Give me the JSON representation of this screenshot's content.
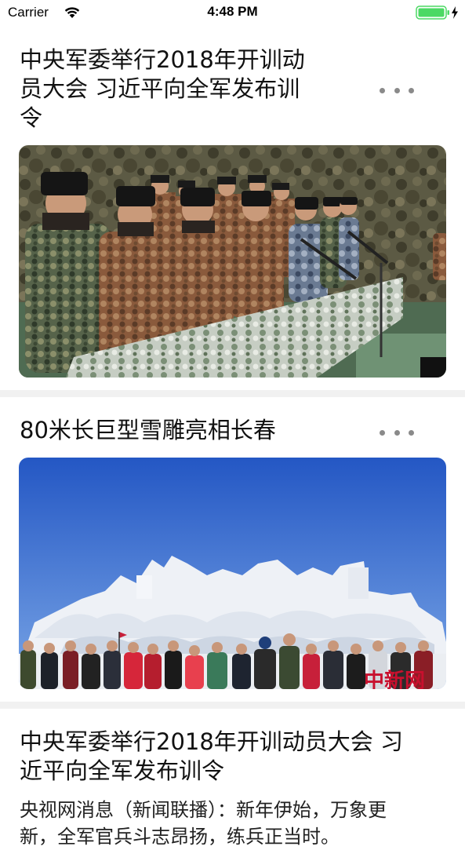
{
  "status_bar": {
    "carrier": "Carrier",
    "time": "4:48 PM",
    "wifi_icon": "wifi-icon",
    "battery_icon": "battery-charging-icon",
    "battery_color": "#4cd964"
  },
  "feed": {
    "items": [
      {
        "title": "中央军委举行2018年开训动员大会 习近平向全军发布训令",
        "title_lines": [
          "中央军委举行2018年开训动",
          "员大会 习近平向全军发布训",
          "令"
        ],
        "more_icon": "more-dots-icon",
        "image": "photo-military-ceremony"
      },
      {
        "title": "80米长巨型雪雕亮相长春",
        "more_icon": "more-dots-icon",
        "image": "photo-snow-sculpture",
        "watermark": "中新网"
      },
      {
        "title_lines": [
          "中央军委举行2018年开训动员大会 习",
          "近平向全军发布训令"
        ],
        "body_lines": [
          "央视网消息（新闻联播）：新年伊始，万象更",
          "新，全军官兵斗志昂扬，练兵正当时。"
        ]
      }
    ]
  },
  "colors": {
    "separator": "#f1f1f1",
    "dots": "#8a8a8a"
  }
}
